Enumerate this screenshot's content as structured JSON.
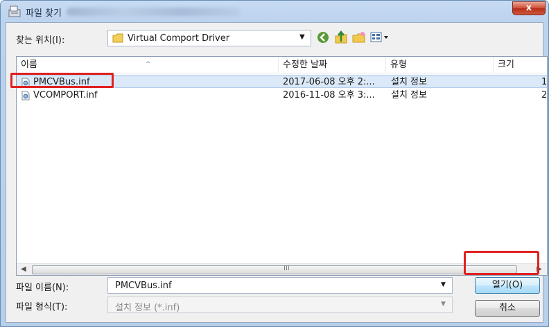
{
  "window": {
    "title": "파일 찾기",
    "close_label": "x"
  },
  "lookin": {
    "label": "찾는 위치(I):",
    "value": "Virtual Comport Driver"
  },
  "toolbar": {
    "icons": [
      "back-icon",
      "up-folder-icon",
      "new-folder-icon",
      "view-menu-icon"
    ]
  },
  "filelist": {
    "columns": [
      "이름",
      "수정한 날짜",
      "유형",
      "크기"
    ],
    "rows": [
      {
        "name": "PMCVBus.inf",
        "date": "2017-06-08 오후 2:...",
        "type": "설치 정보",
        "size": "1",
        "selected": true
      },
      {
        "name": "VCOMPORT.inf",
        "date": "2016-11-08 오후 3:...",
        "type": "설치 정보",
        "size": "2",
        "selected": false
      }
    ],
    "scroll_grip": "III"
  },
  "filename": {
    "label": "파일 이름(N):",
    "value": "PMCVBus.inf"
  },
  "filetype": {
    "label": "파일 형식(T):",
    "value": "설치 정보 (*.inf)"
  },
  "buttons": {
    "open": "열기(O)",
    "cancel": "취소"
  },
  "colors": {
    "highlight": "#e02020",
    "selection": "#dbe8f7",
    "title_bar": "#c7dbf2"
  }
}
